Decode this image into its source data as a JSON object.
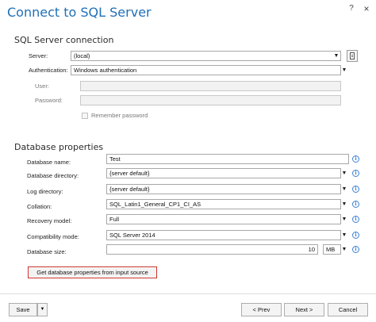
{
  "window": {
    "title": "Connect to SQL Server",
    "help_glyph": "?",
    "close_glyph": "×"
  },
  "connection": {
    "section_title": "SQL Server connection",
    "server_label": "Server:",
    "server_value": "(local)",
    "auth_label": "Authentication:",
    "auth_value": "Windows authentication",
    "user_label": "User:",
    "user_value": "",
    "password_label": "Password:",
    "password_value": "",
    "remember_label": "Remember password"
  },
  "database": {
    "section_title": "Database properties",
    "name_label": "Database name:",
    "name_value": "Test",
    "directory_label": "Database directory:",
    "directory_value": "{server default}",
    "log_label": "Log directory:",
    "log_value": "{server default}",
    "collation_label": "Collation:",
    "collation_value": "SQL_Latin1_General_CP1_CI_AS",
    "recovery_label": "Recovery model:",
    "recovery_value": "Full",
    "compat_label": "Compatibility mode:",
    "compat_value": "SQL Server 2014",
    "size_label": "Database size:",
    "size_value": "10",
    "size_unit": "MB",
    "get_props_label": "Get database properties from input source"
  },
  "footer": {
    "save_label": "Save",
    "prev_label": "< Prev",
    "next_label": "Next >",
    "cancel_label": "Cancel"
  },
  "icons": {
    "dropdown": "▼",
    "info": "i"
  },
  "colors": {
    "title": "#1f6fb7",
    "highlight_border": "#c9302c",
    "info": "#3c7fd6"
  }
}
